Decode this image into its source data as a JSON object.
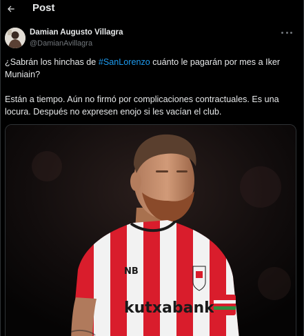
{
  "header": {
    "title": "Post",
    "back_icon": "arrow-left-icon"
  },
  "author": {
    "name": "Damian Augusto Villagra",
    "handle": "@DamianAvillagra",
    "more_icon": "more-horizontal-icon"
  },
  "post": {
    "line1_before": "¿Sabrán los hinchas de ",
    "hashtag": "#SanLorenzo",
    "line1_after": " cuánto le pagarán por mes a Iker Muniain?",
    "paragraph2": "Están a tiempo. Aún no firmó por complicaciones contractuales. Es una locura. Después no expresen enojo si les vacían el club."
  },
  "media": {
    "sponsor_text": "kutxabank",
    "kit_brand": "new-balance-logo",
    "crest": "athletic-club-crest",
    "colors": {
      "red": "#d91d2c",
      "white": "#f2f2f2",
      "skin": "#c98f6f",
      "beard": "#8a4a2a"
    }
  }
}
